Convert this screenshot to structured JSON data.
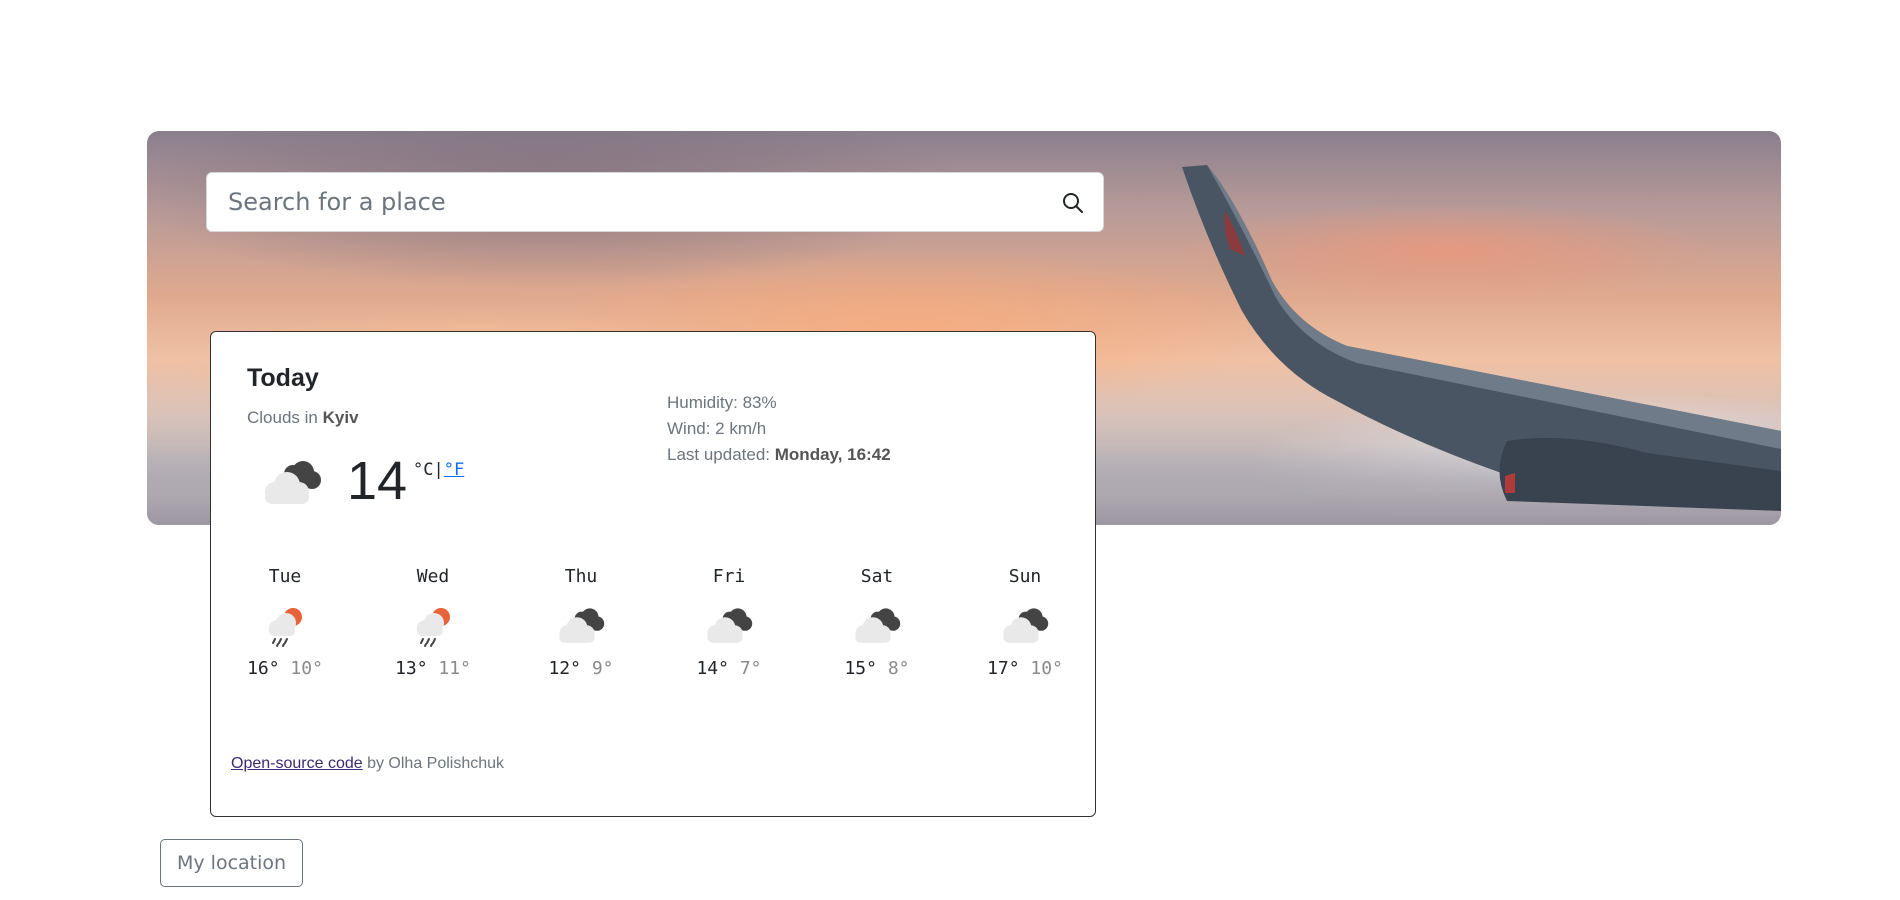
{
  "search": {
    "placeholder": "Search for a place",
    "icon": "search-icon"
  },
  "today": {
    "heading": "Today",
    "description_prefix": "Clouds in ",
    "city": "Kyiv",
    "icon": "broken-clouds-icon",
    "temperature": "14",
    "unit_celsius": "°C",
    "unit_separator": "|",
    "unit_fahrenheit": "°F",
    "humidity": "Humidity: 83%",
    "wind": "Wind: 2 km/h",
    "updated_label": "Last updated: ",
    "updated_value": "Monday, 16:42"
  },
  "forecast": [
    {
      "day": "Tue",
      "icon": "rain-sun-icon",
      "high": "16°",
      "low": "10°"
    },
    {
      "day": "Wed",
      "icon": "rain-sun-icon",
      "high": "13°",
      "low": "11°"
    },
    {
      "day": "Thu",
      "icon": "broken-clouds-icon",
      "high": "12°",
      "low": "9°"
    },
    {
      "day": "Fri",
      "icon": "broken-clouds-icon",
      "high": "14°",
      "low": "7°"
    },
    {
      "day": "Sat",
      "icon": "broken-clouds-icon",
      "high": "15°",
      "low": "8°"
    },
    {
      "day": "Sun",
      "icon": "broken-clouds-icon",
      "high": "17°",
      "low": "10°"
    }
  ],
  "footer": {
    "link_text": "Open-source code",
    "suffix": " by Olha Polishchuk"
  },
  "location_button": "My location",
  "colors": {
    "link": "#0d6efd",
    "sun": "#e8623a",
    "cloud_dark": "#444444",
    "cloud_light": "#e9e9e9"
  }
}
